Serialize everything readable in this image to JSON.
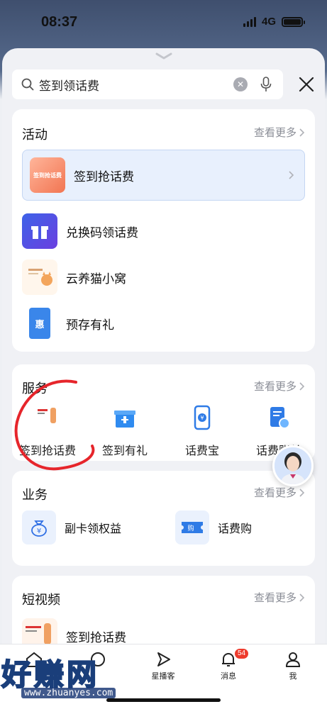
{
  "status": {
    "time": "08:37",
    "network": "4G"
  },
  "search": {
    "value": "签到领话费",
    "placeholder": ""
  },
  "activity": {
    "title": "活动",
    "more": "查看更多",
    "items": [
      {
        "label": "签到抢话费",
        "thumb_text": "签到抢话费"
      },
      {
        "label": "兑换码领话费"
      },
      {
        "label": "云养猫小窝"
      },
      {
        "label": "预存有礼",
        "icon_char": "惠"
      }
    ]
  },
  "services": {
    "title": "服务",
    "more": "查看更多",
    "items": [
      {
        "label": "签到抢话费"
      },
      {
        "label": "签到有礼"
      },
      {
        "label": "话费宝"
      },
      {
        "label": "话费账单"
      }
    ]
  },
  "business": {
    "title": "业务",
    "more": "查看更多",
    "items": [
      {
        "label": "副卡领权益"
      },
      {
        "label": "话费购"
      }
    ]
  },
  "video": {
    "title": "短视频",
    "more": "查看更多",
    "items": [
      {
        "label": "签到抢话费"
      }
    ]
  },
  "tabs": [
    {
      "label": ""
    },
    {
      "label": ""
    },
    {
      "label": "星播客"
    },
    {
      "label": "消息",
      "badge": "54"
    },
    {
      "label": "我"
    }
  ],
  "watermark": {
    "main": "好赚网",
    "url": "www.zhuanyes.com"
  },
  "colors": {
    "accent": "#2f6fe4",
    "highlight_bg": "#e8f0fd",
    "badge": "#ee3b2d",
    "annotation": "#e6252b"
  }
}
